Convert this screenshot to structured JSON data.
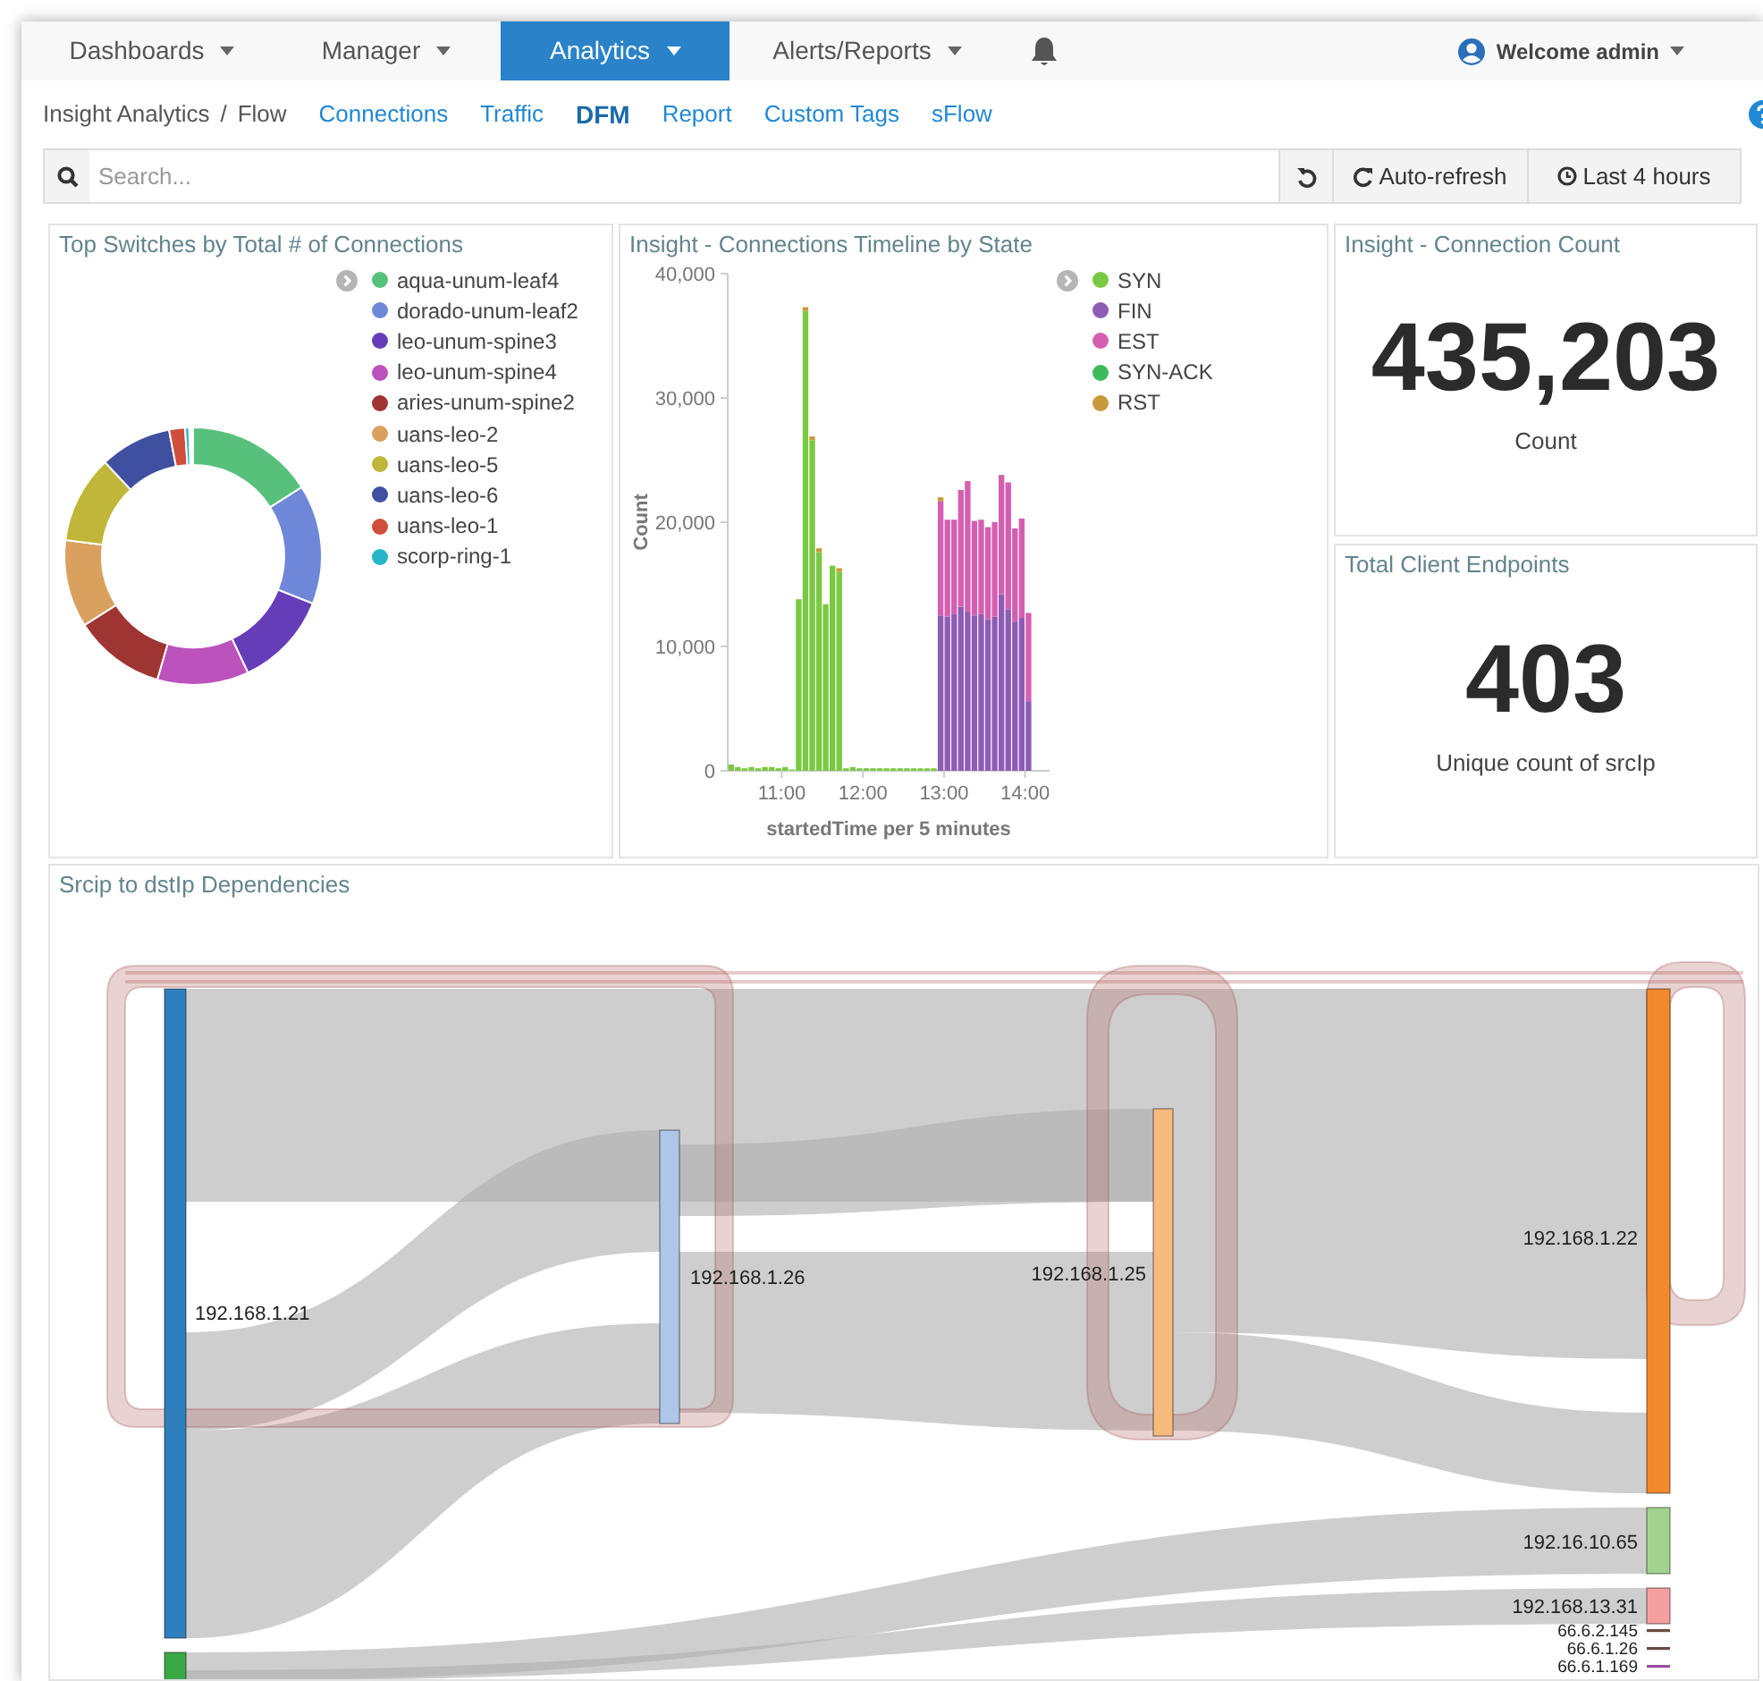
{
  "nav": {
    "items": [
      {
        "label": "Dashboards",
        "selected": false
      },
      {
        "label": "Manager",
        "selected": false
      },
      {
        "label": "Analytics",
        "selected": true
      },
      {
        "label": "Alerts/Reports",
        "selected": false
      }
    ],
    "user": "Welcome admin"
  },
  "breadcrumb": {
    "section": "Insight Analytics",
    "separator": "/",
    "page": "Flow"
  },
  "subnav": [
    {
      "label": "Connections",
      "selected": false
    },
    {
      "label": "Traffic",
      "selected": false
    },
    {
      "label": "DFM",
      "selected": true
    },
    {
      "label": "Report",
      "selected": false
    },
    {
      "label": "Custom Tags",
      "selected": false
    },
    {
      "label": "sFlow",
      "selected": false
    }
  ],
  "search": {
    "placeholder": "Search...",
    "auto_refresh": "Auto-refresh",
    "time_range": "Last 4 hours"
  },
  "top_switches": {
    "title": "Top Switches by Total # of Connections",
    "legend": [
      {
        "label": "aqua-unum-leaf4",
        "color": "#57c17b"
      },
      {
        "label": "dorado-unum-leaf2",
        "color": "#6f87d8"
      },
      {
        "label": "leo-unum-spine3",
        "color": "#663db8"
      },
      {
        "label": "leo-unum-spine4",
        "color": "#bc52bc"
      },
      {
        "label": "aries-unum-spine2",
        "color": "#9e3533"
      },
      {
        "label": "uans-leo-2",
        "color": "#daa05d"
      },
      {
        "label": "uans-leo-5",
        "color": "#bfb63a"
      },
      {
        "label": "uans-leo-6",
        "color": "#4050a0"
      },
      {
        "label": "uans-leo-1",
        "color": "#d04e3c"
      },
      {
        "label": "scorp-ring-1",
        "color": "#26b5c9"
      }
    ]
  },
  "timeline": {
    "chart_data": {
      "type": "bar",
      "stacked": true,
      "title": "Insight - Connections Timeline by State",
      "xlabel": "startedTime per 5 minutes",
      "ylabel": "Count",
      "ylim": [
        0,
        40000
      ],
      "yticks": [
        {
          "value": 0,
          "label": "0"
        },
        {
          "value": 10000,
          "label": "10,000"
        },
        {
          "value": 20000,
          "label": "20,000"
        },
        {
          "value": 30000,
          "label": "30,000"
        },
        {
          "value": 40000,
          "label": "40,000"
        }
      ],
      "xlim": [
        620,
        845
      ],
      "xticks": [
        {
          "value": 660,
          "label": "11:00"
        },
        {
          "value": 720,
          "label": "12:00"
        },
        {
          "value": 780,
          "label": "13:00"
        },
        {
          "value": 840,
          "label": "14:00"
        }
      ],
      "x": [
        620,
        625,
        630,
        635,
        640,
        645,
        650,
        655,
        660,
        665,
        670,
        675,
        680,
        685,
        690,
        695,
        700,
        705,
        710,
        715,
        720,
        725,
        730,
        735,
        740,
        745,
        750,
        755,
        760,
        765,
        770,
        775,
        780,
        785,
        790,
        795,
        800,
        805,
        810,
        815,
        820,
        825,
        830,
        835,
        840
      ],
      "series": [
        {
          "name": "SYN",
          "color": "#7ac943",
          "values": [
            500,
            300,
            200,
            300,
            200,
            300,
            300,
            200,
            300,
            100,
            13800,
            37000,
            26600,
            17600,
            13400,
            16500,
            16000,
            200,
            300,
            200,
            200,
            200,
            200,
            200,
            200,
            200,
            200,
            200,
            200,
            200,
            200,
            0,
            0,
            0,
            0,
            0,
            0,
            0,
            0,
            0,
            0,
            0,
            0,
            0,
            0
          ]
        },
        {
          "name": "FIN",
          "color": "#8e5bb5",
          "values": [
            0,
            0,
            0,
            0,
            0,
            0,
            0,
            0,
            0,
            0,
            0,
            0,
            0,
            0,
            0,
            0,
            0,
            0,
            0,
            0,
            0,
            0,
            0,
            0,
            0,
            0,
            0,
            0,
            0,
            0,
            0,
            12500,
            12400,
            12600,
            13200,
            12800,
            12500,
            12600,
            12200,
            12400,
            14200,
            13000,
            12000,
            12300,
            5600
          ]
        },
        {
          "name": "EST",
          "color": "#d45fb0",
          "values": [
            0,
            0,
            0,
            0,
            0,
            0,
            0,
            0,
            0,
            0,
            0,
            0,
            0,
            0,
            0,
            0,
            0,
            0,
            0,
            0,
            0,
            0,
            0,
            0,
            0,
            0,
            0,
            0,
            0,
            0,
            0,
            9200,
            7800,
            7600,
            9400,
            10500,
            7600,
            7600,
            7400,
            7600,
            9600,
            10200,
            7500,
            8000,
            7100
          ]
        },
        {
          "name": "SYN-ACK",
          "color": "#3dbb5b",
          "values": [
            0,
            0,
            0,
            0,
            0,
            0,
            0,
            0,
            0,
            0,
            0,
            0,
            0,
            0,
            0,
            0,
            0,
            0,
            0,
            0,
            0,
            0,
            0,
            0,
            0,
            0,
            0,
            0,
            0,
            0,
            0,
            0,
            0,
            0,
            0,
            0,
            0,
            0,
            0,
            0,
            0,
            0,
            0,
            0,
            0
          ]
        },
        {
          "name": "RST",
          "color": "#c99a3c",
          "values": [
            0,
            0,
            0,
            0,
            0,
            0,
            0,
            0,
            0,
            0,
            0,
            300,
            300,
            300,
            0,
            0,
            300,
            0,
            0,
            0,
            0,
            0,
            0,
            0,
            0,
            0,
            0,
            0,
            0,
            0,
            0,
            300,
            0,
            0,
            0,
            0,
            0,
            0,
            0,
            0,
            0,
            0,
            0,
            0,
            0
          ]
        }
      ]
    }
  },
  "connection_count": {
    "title": "Insight - Connection Count",
    "value": "435,203",
    "label": "Count"
  },
  "client_endpoints": {
    "title": "Total Client Endpoints",
    "value": "403",
    "label": "Unique count of srcIp"
  },
  "dependencies": {
    "title": "Srcip to dstIp Dependencies",
    "nodes": [
      {
        "label": "192.168.1.21",
        "color": "#2f7fbf"
      },
      {
        "color": "#3aa845"
      },
      {
        "label": "192.168.1.26",
        "color": "#aec7e8"
      },
      {
        "label": "192.168.1.25",
        "color": "#f8bb7e"
      },
      {
        "label": "192.168.1.22",
        "color": "#f28a2c"
      },
      {
        "label": "192.16.10.65",
        "color": "#a2d38e"
      },
      {
        "label": "192.168.13.31",
        "color": "#f5a0a0"
      },
      {
        "label": "66.6.2.145",
        "color": "#6b4a45"
      },
      {
        "label": "66.6.1.26",
        "color": "#6b4a45"
      },
      {
        "label": "66.6.1.169",
        "color": "#9b4fa0"
      }
    ]
  }
}
